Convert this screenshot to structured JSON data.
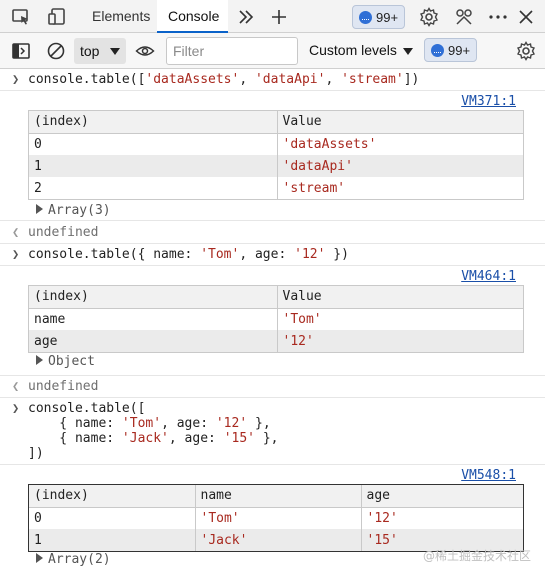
{
  "tabs": {
    "elements": "Elements",
    "console": "Console"
  },
  "issues_badge": "99+",
  "toolbar": {
    "context": "top",
    "filter_placeholder": "Filter",
    "levels": "Custom levels",
    "issues_badge": "99+"
  },
  "entries": {
    "cmd1": {
      "pre": "console.table([",
      "s1": "'dataAssets'",
      "c1": ", ",
      "s2": "'dataApi'",
      "c2": ", ",
      "s3": "'stream'",
      "post": "])"
    },
    "src1": "VM371:1",
    "table1": {
      "headers": [
        "(index)",
        "Value"
      ],
      "rows": [
        [
          "0",
          "'dataAssets'"
        ],
        [
          "1",
          "'dataApi'"
        ],
        [
          "2",
          "'stream'"
        ]
      ]
    },
    "array1": "Array(3)",
    "undef1": "undefined",
    "cmd2": {
      "pre": "console.table({ name: ",
      "s1": "'Tom'",
      "mid": ", age: ",
      "s2": "'12'",
      "post": " })"
    },
    "src2": "VM464:1",
    "table2": {
      "headers": [
        "(index)",
        "Value"
      ],
      "rows": [
        [
          "name",
          "'Tom'"
        ],
        [
          "age",
          "'12'"
        ]
      ]
    },
    "object2": "Object",
    "undef2": "undefined",
    "cmd3": {
      "l1": "console.table([",
      "l2a": "    { name: ",
      "l2s1": "'Tom'",
      "l2b": ", age: ",
      "l2s2": "'12'",
      "l2c": " },",
      "l3a": "    { name: ",
      "l3s1": "'Jack'",
      "l3b": ", age: ",
      "l3s2": "'15'",
      "l3c": " },",
      "l4": "])"
    },
    "src3": "VM548:1",
    "table3": {
      "headers": [
        "(index)",
        "name",
        "age"
      ],
      "rows": [
        [
          "0",
          "'Tom'",
          "'12'"
        ],
        [
          "1",
          "'Jack'",
          "'15'"
        ]
      ]
    },
    "array3": "Array(2)"
  },
  "watermark": "@稀土掘金技术社区"
}
